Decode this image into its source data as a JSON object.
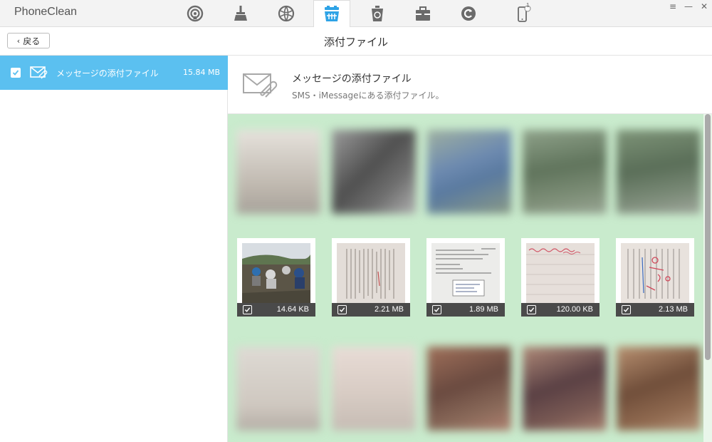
{
  "app": {
    "name": "PhoneClean"
  },
  "toolbar": {
    "icons": [
      "airplay-icon",
      "clean-broom-icon",
      "internet-globe-icon",
      "attachments-basket-icon",
      "recycle-bin-icon",
      "toolbox-icon",
      "restore-icon",
      "iphone-icon"
    ],
    "active": "attachments-basket-icon",
    "device_badge": "1"
  },
  "subbar": {
    "back_label": "戻る",
    "title": "添付ファイル"
  },
  "sidebar": {
    "items": [
      {
        "label": "メッセージの添付ファイル",
        "size": "15.84 MB",
        "checked": true,
        "icon": "mail-attachment-icon"
      }
    ]
  },
  "header": {
    "title": "メッセージの添付ファイル",
    "subtitle": "SMS・iMessageにある添付ファイル。"
  },
  "thumbnails": [
    {
      "size": "14.64 KB",
      "checked": true,
      "kind": "field-photo"
    },
    {
      "size": "2.21 MB",
      "checked": true,
      "kind": "document"
    },
    {
      "size": "1.89 MB",
      "checked": true,
      "kind": "form"
    },
    {
      "size": "120.00 KB",
      "checked": true,
      "kind": "handwritten"
    },
    {
      "size": "2.13 MB",
      "checked": true,
      "kind": "marked-document"
    }
  ],
  "colors": {
    "accent": "#5bc0f0",
    "active_icon": "#2ea3e6",
    "grid_bg": "#c9ebcd",
    "icon_gray": "#6b6b6b"
  }
}
